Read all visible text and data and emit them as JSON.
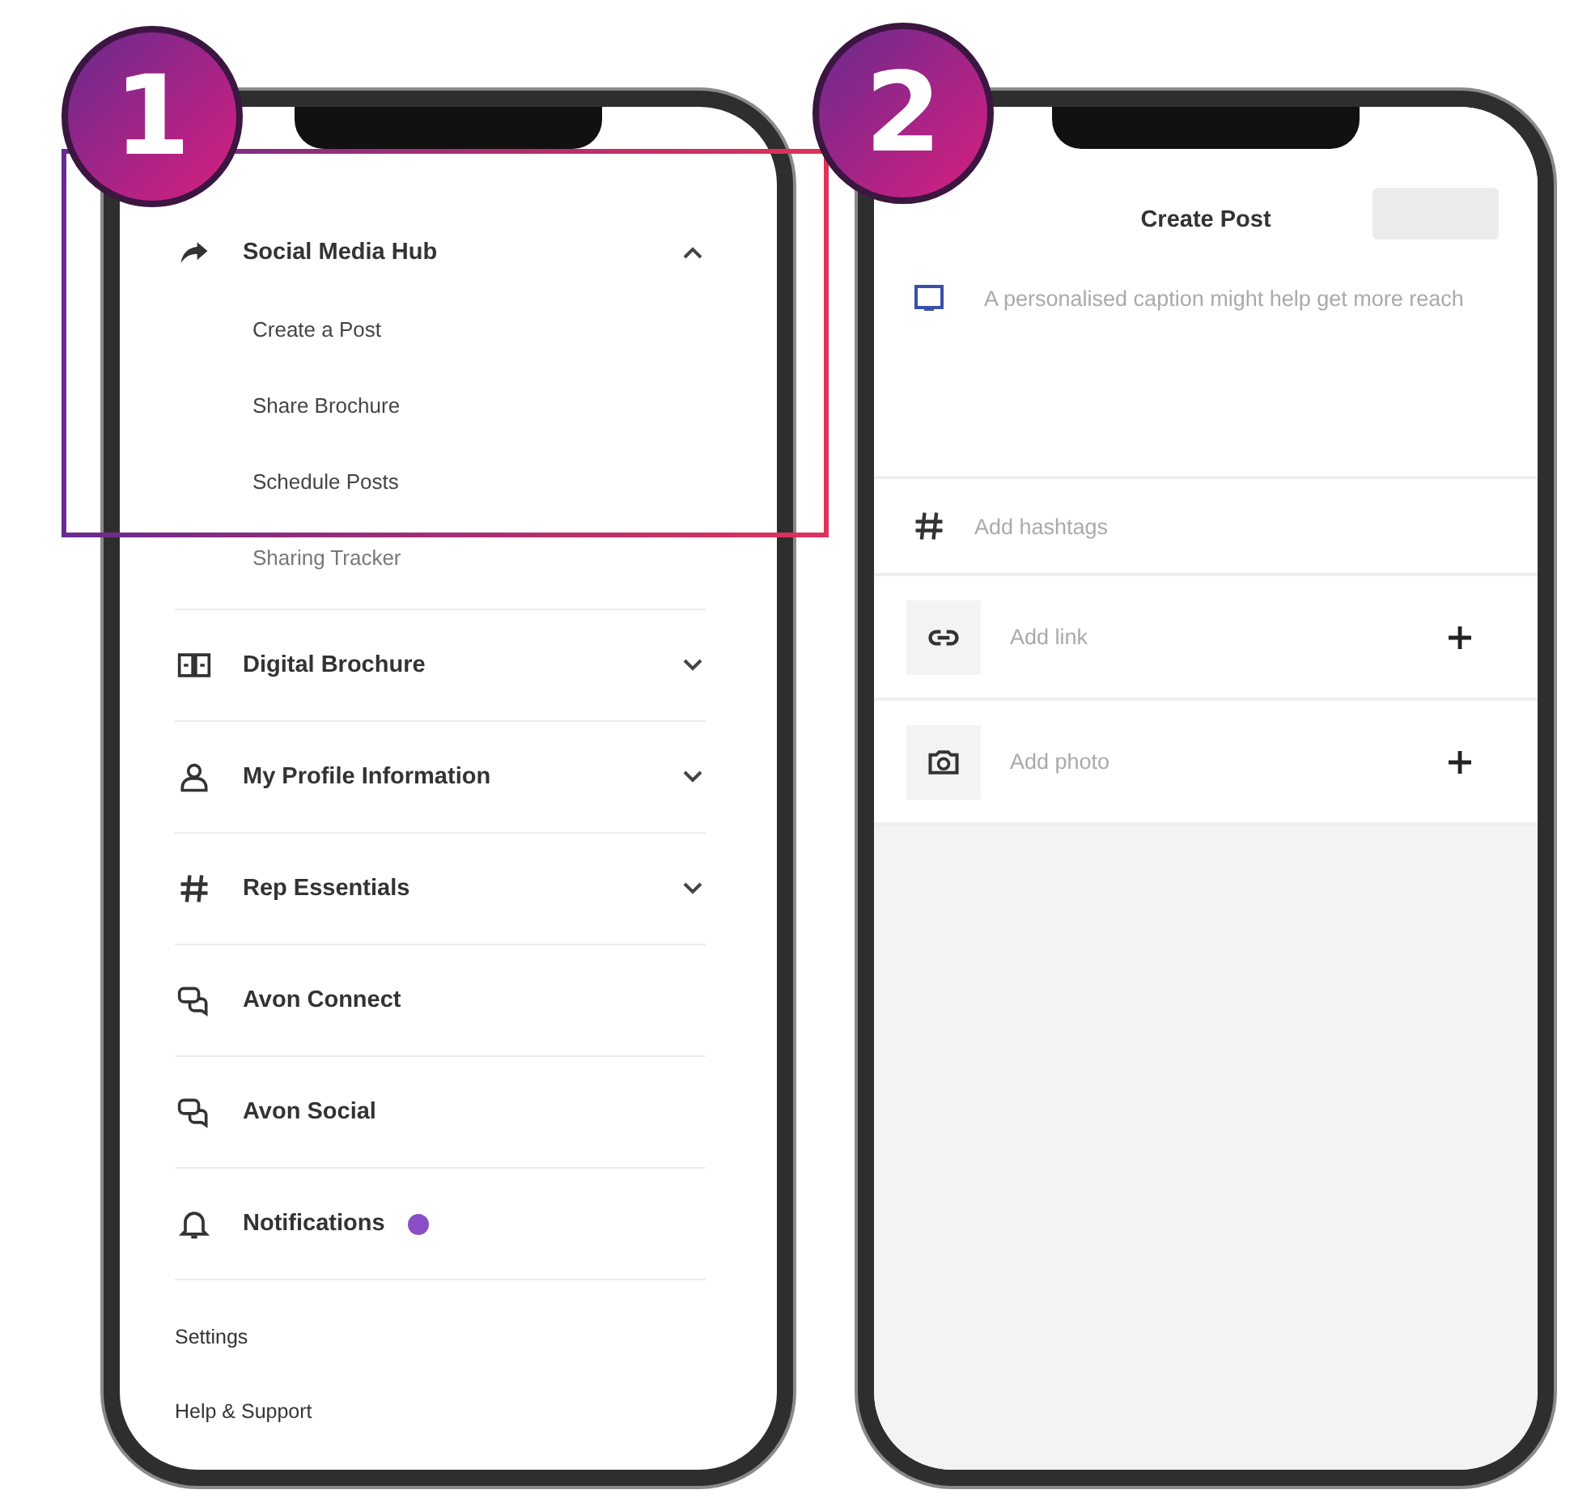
{
  "left_phone": {
    "badge": "1",
    "highlight": true,
    "menu": {
      "items": [
        {
          "kind": "group",
          "label": "Social Media Hub",
          "expanded": true,
          "alert": false,
          "children": [
            {
              "label": "Create a Post"
            },
            {
              "label": "Share Brochure"
            },
            {
              "label": "Schedule Posts"
            },
            {
              "label": "Sharing Tracker"
            }
          ]
        },
        {
          "kind": "group",
          "label": "Digital Brochure",
          "expanded": false,
          "alert": false
        },
        {
          "kind": "group",
          "label": "My Profile Information",
          "expanded": false,
          "alert": false
        },
        {
          "kind": "group",
          "label": "Rep Essentials",
          "expanded": false,
          "alert": false
        },
        {
          "kind": "link",
          "label": "Avon Connect",
          "alert": false
        },
        {
          "kind": "link",
          "label": "Avon Social",
          "alert": false
        },
        {
          "kind": "link",
          "label": "Notifications",
          "alert": true
        }
      ],
      "footer_links": [
        "Settings",
        "Help & Support"
      ]
    }
  },
  "right_phone": {
    "badge": "2",
    "title": "Create Post",
    "post_button": {
      "disabled": true
    },
    "caption": {
      "placeholder": "A personalised caption might help get more reach"
    },
    "hashtags": {
      "placeholder": "Add hashtags"
    },
    "attachments": [
      {
        "label": "Add link"
      },
      {
        "label": "Add photo"
      }
    ]
  }
}
